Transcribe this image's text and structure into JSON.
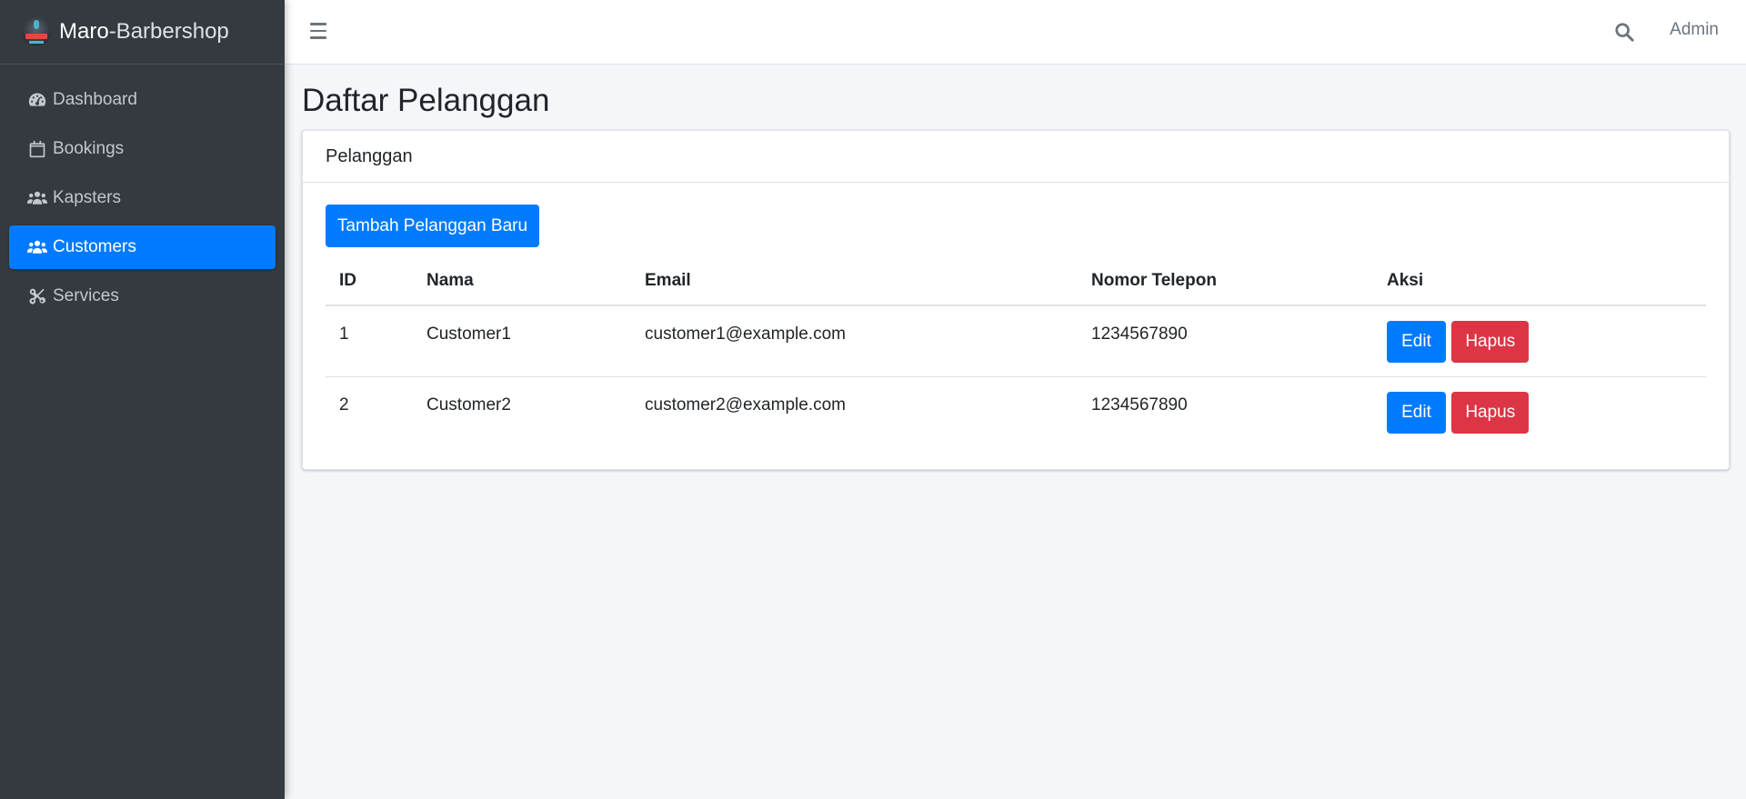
{
  "brand": {
    "strong": "Maro",
    "rest": "-Barbershop"
  },
  "sidebar": {
    "items": [
      {
        "label": "Dashboard",
        "icon": "tachometer-icon"
      },
      {
        "label": "Bookings",
        "icon": "calendar-icon"
      },
      {
        "label": "Kapsters",
        "icon": "users-icon"
      },
      {
        "label": "Customers",
        "icon": "users-icon",
        "active": true
      },
      {
        "label": "Services",
        "icon": "scissors-icon"
      }
    ]
  },
  "topbar": {
    "user": "Admin"
  },
  "page": {
    "title": "Daftar Pelanggan"
  },
  "card": {
    "header": "Pelanggan",
    "add_button": "Tambah Pelanggan Baru",
    "table": {
      "headers": [
        "ID",
        "Nama",
        "Email",
        "Nomor Telepon",
        "Aksi"
      ],
      "rows": [
        {
          "id": "1",
          "name": "Customer1",
          "email": "customer1@example.com",
          "phone": "1234567890",
          "edit": "Edit",
          "delete": "Hapus"
        },
        {
          "id": "2",
          "name": "Customer2",
          "email": "customer2@example.com",
          "phone": "1234567890",
          "edit": "Edit",
          "delete": "Hapus"
        }
      ]
    }
  },
  "colors": {
    "primary": "#007bff",
    "danger": "#dc3545",
    "sidebar": "#343a40"
  }
}
